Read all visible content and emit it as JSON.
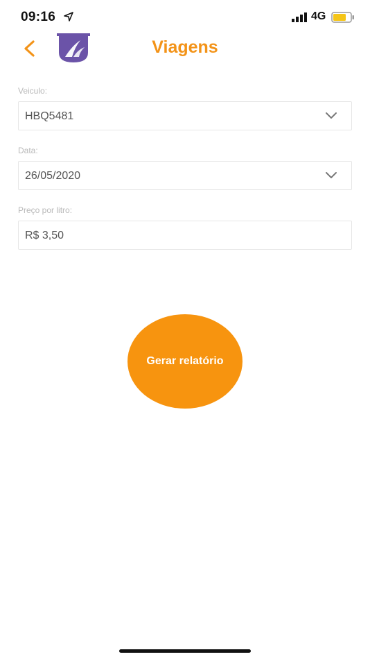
{
  "status_bar": {
    "time": "09:16",
    "network": "4G",
    "icons": [
      "location-arrow-icon",
      "signal-icon",
      "battery-icon"
    ],
    "battery_level": 0.75,
    "battery_color": "#f5c518"
  },
  "header": {
    "title": "Viagens",
    "back_icon": "chevron-left-icon",
    "logo_icon": "road-shield-logo",
    "accent_color": "#f39318",
    "logo_color": "#6b53a8"
  },
  "form": {
    "vehicle": {
      "label": "Veiculo:",
      "value": "HBQ5481",
      "icon": "chevron-down-icon"
    },
    "date": {
      "label": "Data:",
      "value": "26/05/2020",
      "icon": "chevron-down-icon"
    },
    "price": {
      "label": "Preço por litro:",
      "value": "R$ 3,50"
    }
  },
  "actions": {
    "generate_label": "Gerar relatório",
    "button_color": "#f7940f"
  }
}
